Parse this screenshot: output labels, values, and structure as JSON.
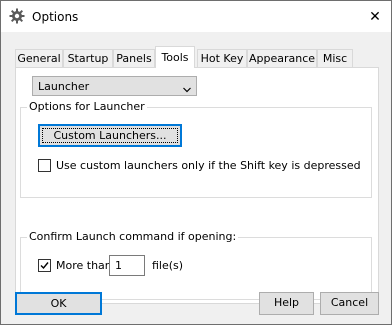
{
  "window": {
    "title": "Options",
    "close_glyph": "✕"
  },
  "tabs": [
    {
      "label": "General",
      "active": false
    },
    {
      "label": "Startup",
      "active": false
    },
    {
      "label": "Panels",
      "active": false
    },
    {
      "label": "Tools",
      "active": true
    },
    {
      "label": "Hot Key",
      "active": false
    },
    {
      "label": "Appearance",
      "active": false
    },
    {
      "label": "Misc",
      "active": false
    }
  ],
  "tools": {
    "tool_select": {
      "value": "Launcher"
    },
    "options_group": {
      "label": "Options for Launcher",
      "custom_launchers_button": "Custom Launchers...",
      "shift_checkbox": {
        "label": "Use custom launchers only if the Shift key is depressed",
        "checked": false
      }
    },
    "confirm_group": {
      "label": "Confirm Launch command if opening:",
      "more_than_checkbox": {
        "label": "More than",
        "checked": true
      },
      "file_count": "1",
      "files_suffix": "file(s)"
    }
  },
  "footer": {
    "ok_label": "OK",
    "help_label": "Help",
    "cancel_label": "Cancel"
  },
  "icons": {
    "title_icon": "gear-icon"
  },
  "colors": {
    "focus_border": "#0078d7",
    "panel_bg": "#ffffff",
    "dialog_bg": "#f0f0f0"
  }
}
